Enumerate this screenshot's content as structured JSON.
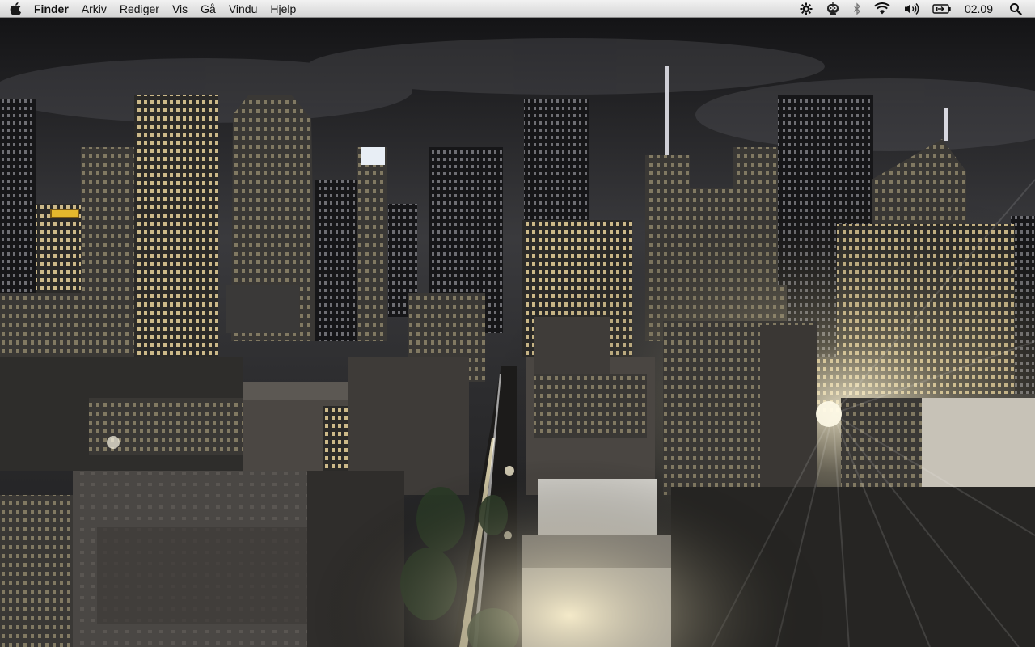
{
  "menubar": {
    "apple_icon": "apple-logo-icon",
    "app_name": "Finder",
    "items": [
      {
        "label": "Arkiv"
      },
      {
        "label": "Rediger"
      },
      {
        "label": "Vis"
      },
      {
        "label": "Gå"
      },
      {
        "label": "Vindu"
      },
      {
        "label": "Hjelp"
      }
    ],
    "status_icons": [
      "gear-icon",
      "robot-icon",
      "bluetooth-icon",
      "wifi-icon",
      "volume-icon",
      "battery-icon",
      "spotlight-search-icon"
    ],
    "clock": "02.09"
  },
  "desktop": {
    "wallpaper": "night-city-skyline",
    "colors": {
      "sky": "#2a2a2c",
      "window_light": "#f0d9a0",
      "street_light": "#fff6d8"
    }
  }
}
